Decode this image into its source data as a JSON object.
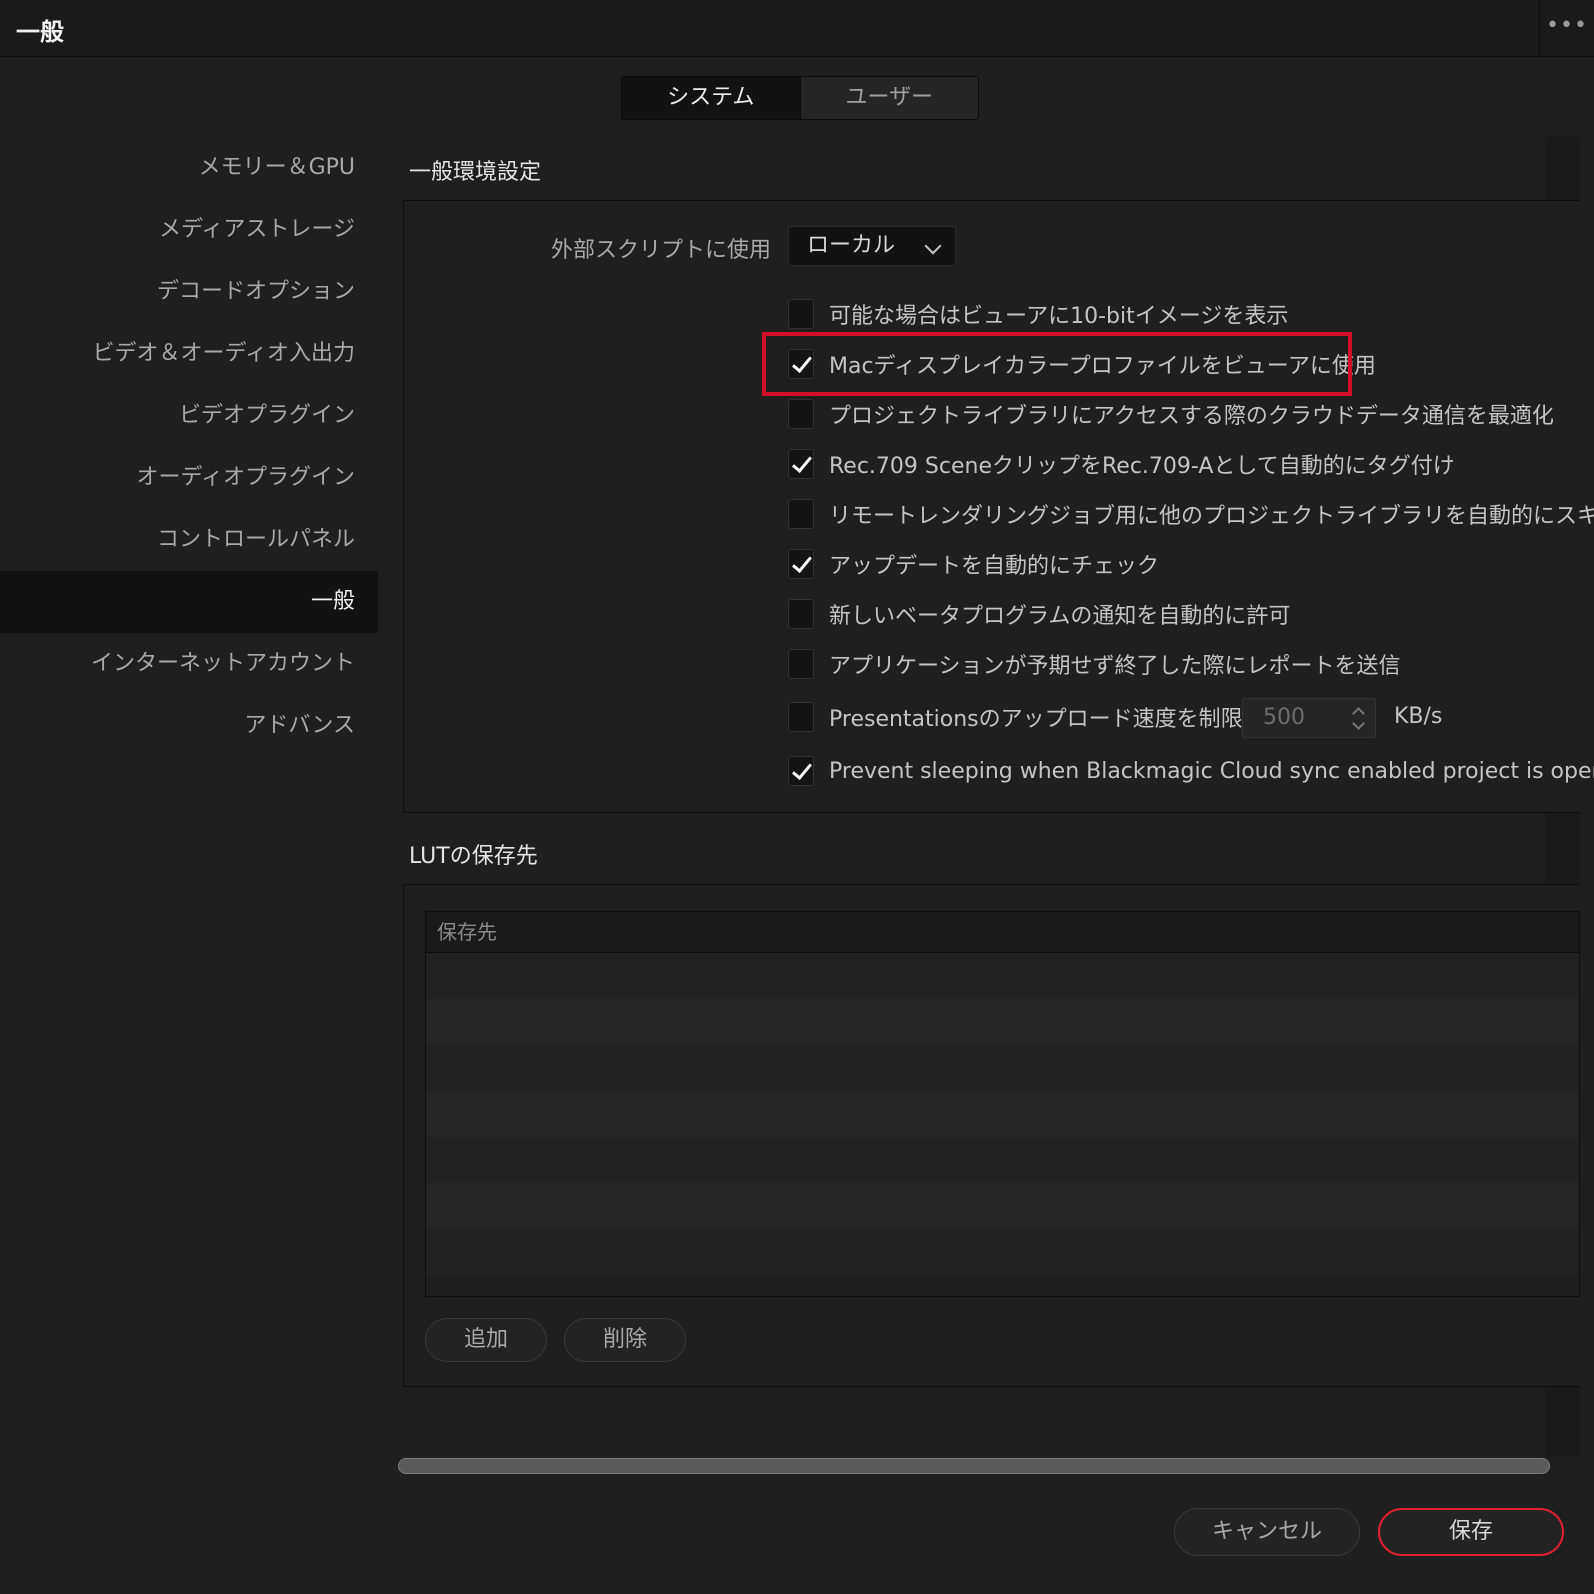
{
  "window": {
    "title": "一般",
    "more_icon": "•••"
  },
  "tabs": [
    {
      "label": "システム"
    },
    {
      "label": "ユーザー"
    }
  ],
  "sidebar": {
    "items": [
      {
        "label": "メモリー＆GPU"
      },
      {
        "label": "メディアストレージ"
      },
      {
        "label": "デコードオプション"
      },
      {
        "label": "ビデオ＆オーディオ入出力"
      },
      {
        "label": "ビデオプラグイン"
      },
      {
        "label": "オーディオプラグイン"
      },
      {
        "label": "コントロールパネル"
      },
      {
        "label": "一般"
      },
      {
        "label": "インターネットアカウント"
      },
      {
        "label": "アドバンス"
      }
    ],
    "active_index": 7
  },
  "general": {
    "section_title": "一般環境設定",
    "external_script_label": "外部スクリプトに使用",
    "external_script_value": "ローカル",
    "options": [
      {
        "label": "可能な場合はビューアに10-bitイメージを表示",
        "checked": false
      },
      {
        "label": "Macディスプレイカラープロファイルをビューアに使用",
        "checked": true
      },
      {
        "label": "プロジェクトライブラリにアクセスする際のクラウドデータ通信を最適化",
        "checked": false
      },
      {
        "label": "Rec.709 SceneクリップをRec.709-Aとして自動的にタグ付け",
        "checked": true
      },
      {
        "label": "リモートレンダリングジョブ用に他のプロジェクトライブラリを自動的にスキャン",
        "checked": false
      },
      {
        "label": "アップデートを自動的にチェック",
        "checked": true
      },
      {
        "label": "新しいベータプログラムの通知を自動的に許可",
        "checked": false
      },
      {
        "label": "アプリケーションが予期せず終了した際にレポートを送信",
        "checked": false
      },
      {
        "label": "Presentationsのアップロード速度を制限：",
        "checked": false
      },
      {
        "label": "Prevent sleeping when Blackmagic Cloud sync enabled project is open",
        "checked": true
      }
    ],
    "upload_speed_value": "500",
    "upload_speed_unit": "KB/s",
    "highlight_color": "#d0102a"
  },
  "lut": {
    "section_title": "LUTの保存先",
    "column_header": "保存先",
    "add_label": "追加",
    "delete_label": "削除"
  },
  "footer": {
    "cancel_label": "キャンセル",
    "save_label": "保存",
    "accent_color": "#e0202e"
  }
}
